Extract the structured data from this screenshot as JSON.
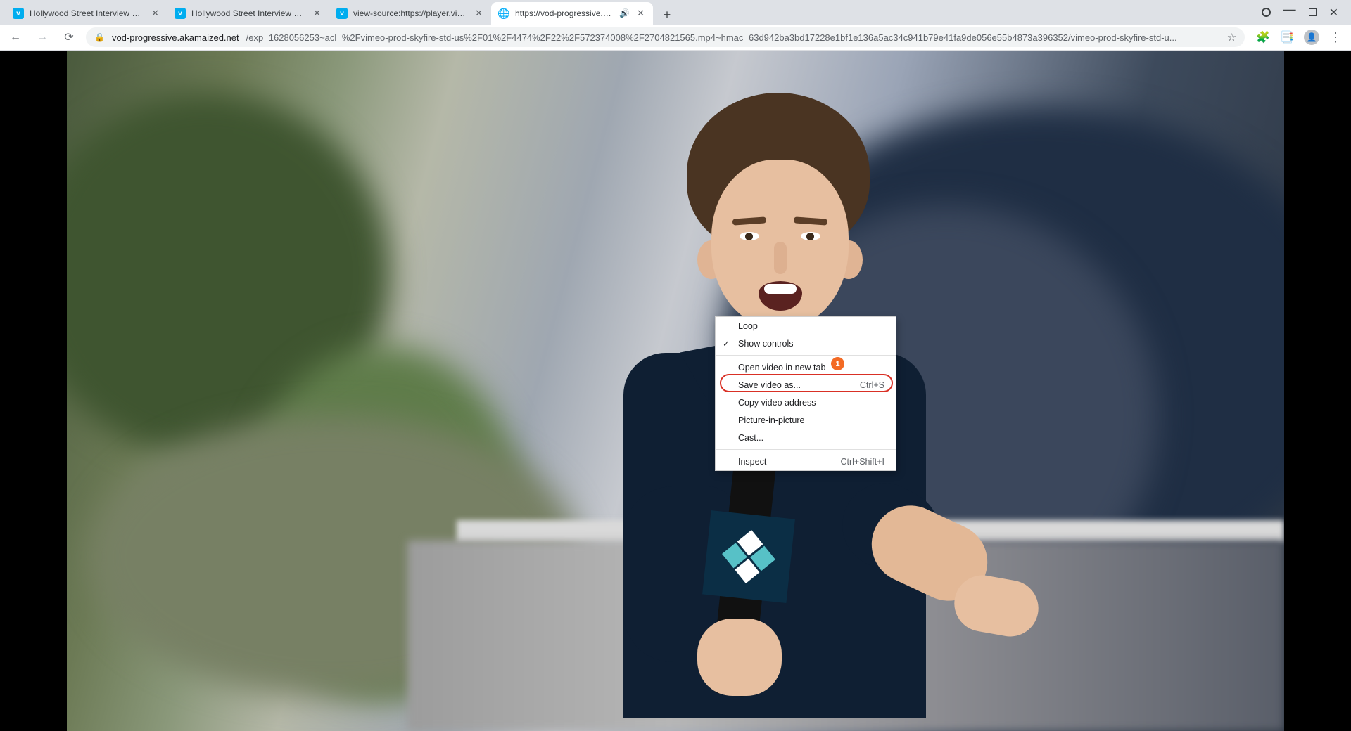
{
  "tabs": [
    {
      "title": "Hollywood Street Interview with",
      "favicon": "vimeo",
      "audio": false,
      "active": false
    },
    {
      "title": "Hollywood Street Interview with",
      "favicon": "vimeo",
      "audio": false,
      "active": false
    },
    {
      "title": "view-source:https://player.vimeo",
      "favicon": "vimeo",
      "audio": false,
      "active": false
    },
    {
      "title": "https://vod-progressive.akam",
      "favicon": "globe",
      "audio": true,
      "active": true
    }
  ],
  "new_tab_glyph": "+",
  "window_controls": {
    "minimize": "—",
    "maximize": "□",
    "close": "✕"
  },
  "nav": {
    "back": "←",
    "forward": "→",
    "reload": "⟳"
  },
  "address": {
    "lock_glyph": "🔒",
    "host": "vod-progressive.akamaized.net",
    "path": "/exp=1628056253~acl=%2Fvimeo-prod-skyfire-std-us%2F01%2F4474%2F22%2F572374008%2F2704821565.mp4~hmac=63d942ba3bd17228e1bf1e136a5ac34c941b79e41fa9de056e55b4873a396352/vimeo-prod-skyfire-std-u...",
    "star_glyph": "☆"
  },
  "toolbar_icons": {
    "extensions": "🧩",
    "reading_list": "📑",
    "profile": "👤",
    "menu": "⋮"
  },
  "context_menu": {
    "loop": "Loop",
    "show_controls": "Show controls",
    "open_new_tab": "Open video in new tab",
    "save_as": "Save video as...",
    "save_as_kbd": "Ctrl+S",
    "copy_addr": "Copy video address",
    "pip": "Picture-in-picture",
    "cast": "Cast...",
    "inspect": "Inspect",
    "inspect_kbd": "Ctrl+Shift+I",
    "check_glyph": "✓"
  },
  "annotation": {
    "badge": "1"
  }
}
